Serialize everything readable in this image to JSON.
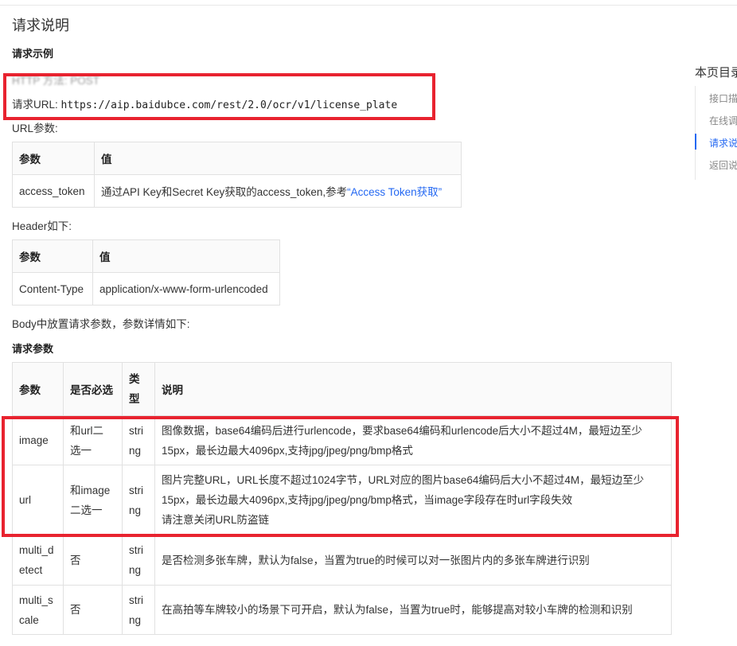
{
  "page": {
    "section_title": "请求说明",
    "example_heading": "请求示例",
    "http_method_obscured": "HTTP 方法: POST",
    "url_label": "请求URL: ",
    "url_value": "https://aip.baidubce.com/rest/2.0/ocr/v1/license_plate",
    "url_params_label": "URL参数:",
    "header_label": "Header如下:",
    "body_label": "Body中放置请求参数，参数详情如下:",
    "request_params_heading": "请求参数"
  },
  "url_params_table": {
    "headers": [
      "参数",
      "值"
    ],
    "row": {
      "param": "access_token",
      "value_text": "通过API Key和Secret Key获取的access_token,参考",
      "value_link": "“Access Token获取”"
    }
  },
  "header_table": {
    "headers": [
      "参数",
      "值"
    ],
    "row": {
      "param": "Content-Type",
      "value": "application/x-www-form-urlencoded"
    }
  },
  "params_table": {
    "headers": {
      "param": "参数",
      "required": "是否必选",
      "type": [
        "类",
        "型"
      ],
      "desc": "说明"
    },
    "rows": [
      {
        "param": [
          "image"
        ],
        "required": [
          "和url二",
          "选一"
        ],
        "type": [
          "stri",
          "ng"
        ],
        "desc": [
          "图像数据，base64编码后进行urlencode，要求base64编码和urlencode后大小不超过4M，最短边至少",
          "15px，最长边最大4096px,支持jpg/jpeg/png/bmp格式"
        ]
      },
      {
        "param": [
          "url"
        ],
        "required": [
          "和image",
          "二选一"
        ],
        "type": [
          "stri",
          "ng"
        ],
        "desc": [
          "图片完整URL，URL长度不超过1024字节，URL对应的图片base64编码后大小不超过4M，最短边至少",
          "15px，最长边最大4096px,支持jpg/jpeg/png/bmp格式，当image字段存在时url字段失效",
          "请注意关闭URL防盗链"
        ]
      },
      {
        "param": [
          "multi_d",
          "etect"
        ],
        "required": [
          "否"
        ],
        "type": [
          "stri",
          "ng"
        ],
        "desc": [
          "是否检测多张车牌，默认为false，当置为true的时候可以对一张图片内的多张车牌进行识别"
        ]
      },
      {
        "param": [
          "multi_s",
          "cale"
        ],
        "required": [
          "否"
        ],
        "type": [
          "stri",
          "ng"
        ],
        "desc": [
          "在高拍等车牌较小的场景下可开启，默认为false，当置为true时，能够提高对较小车牌的检测和识别"
        ]
      }
    ]
  },
  "toc": {
    "title": "本页目录",
    "items": [
      "接口描述",
      "在线调试",
      "请求说明",
      "返回说明"
    ],
    "active_index": 2
  },
  "colors": {
    "accent": "#2468f2",
    "highlight_box": "#e8232f"
  }
}
